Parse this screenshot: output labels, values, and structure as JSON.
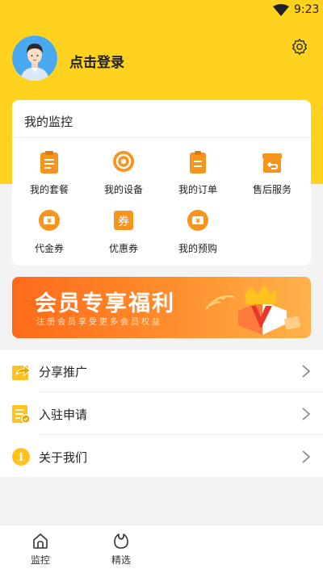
{
  "status_bar": {
    "time": "9:23"
  },
  "header": {
    "login_text": "点击登录"
  },
  "monitor_card": {
    "title": "我的监控",
    "items": [
      {
        "label": "我的套餐",
        "icon": "clipboard-icon"
      },
      {
        "label": "我的设备",
        "icon": "device-target-icon"
      },
      {
        "label": "我的订单",
        "icon": "order-icon"
      },
      {
        "label": "售后服务",
        "icon": "after-sales-icon"
      },
      {
        "label": "代金券",
        "icon": "cash-voucher-icon"
      },
      {
        "label": "优惠券",
        "icon": "coupon-icon"
      },
      {
        "label": "我的预购",
        "icon": "presale-icon"
      }
    ],
    "coupon_glyph": "券",
    "voucher_glyph": "¥"
  },
  "banner": {
    "title": "会员专享福利",
    "subtitle": "注册会员享受更多会员权益",
    "logo_letter": "V"
  },
  "menu": {
    "items": [
      {
        "label": "分享推广",
        "icon": "share-icon"
      },
      {
        "label": "入驻申请",
        "icon": "application-form-icon"
      },
      {
        "label": "关于我们",
        "icon": "info-icon"
      }
    ],
    "info_glyph": "i"
  },
  "tabbar": {
    "tabs": [
      {
        "label": "监控",
        "icon": "home-icon"
      },
      {
        "label": "精选",
        "icon": "featured-icon"
      }
    ]
  },
  "colors": {
    "primary_yellow": "#ffd21f",
    "icon_orange": "#f7941d",
    "banner_orange": "#ff6a1a"
  }
}
